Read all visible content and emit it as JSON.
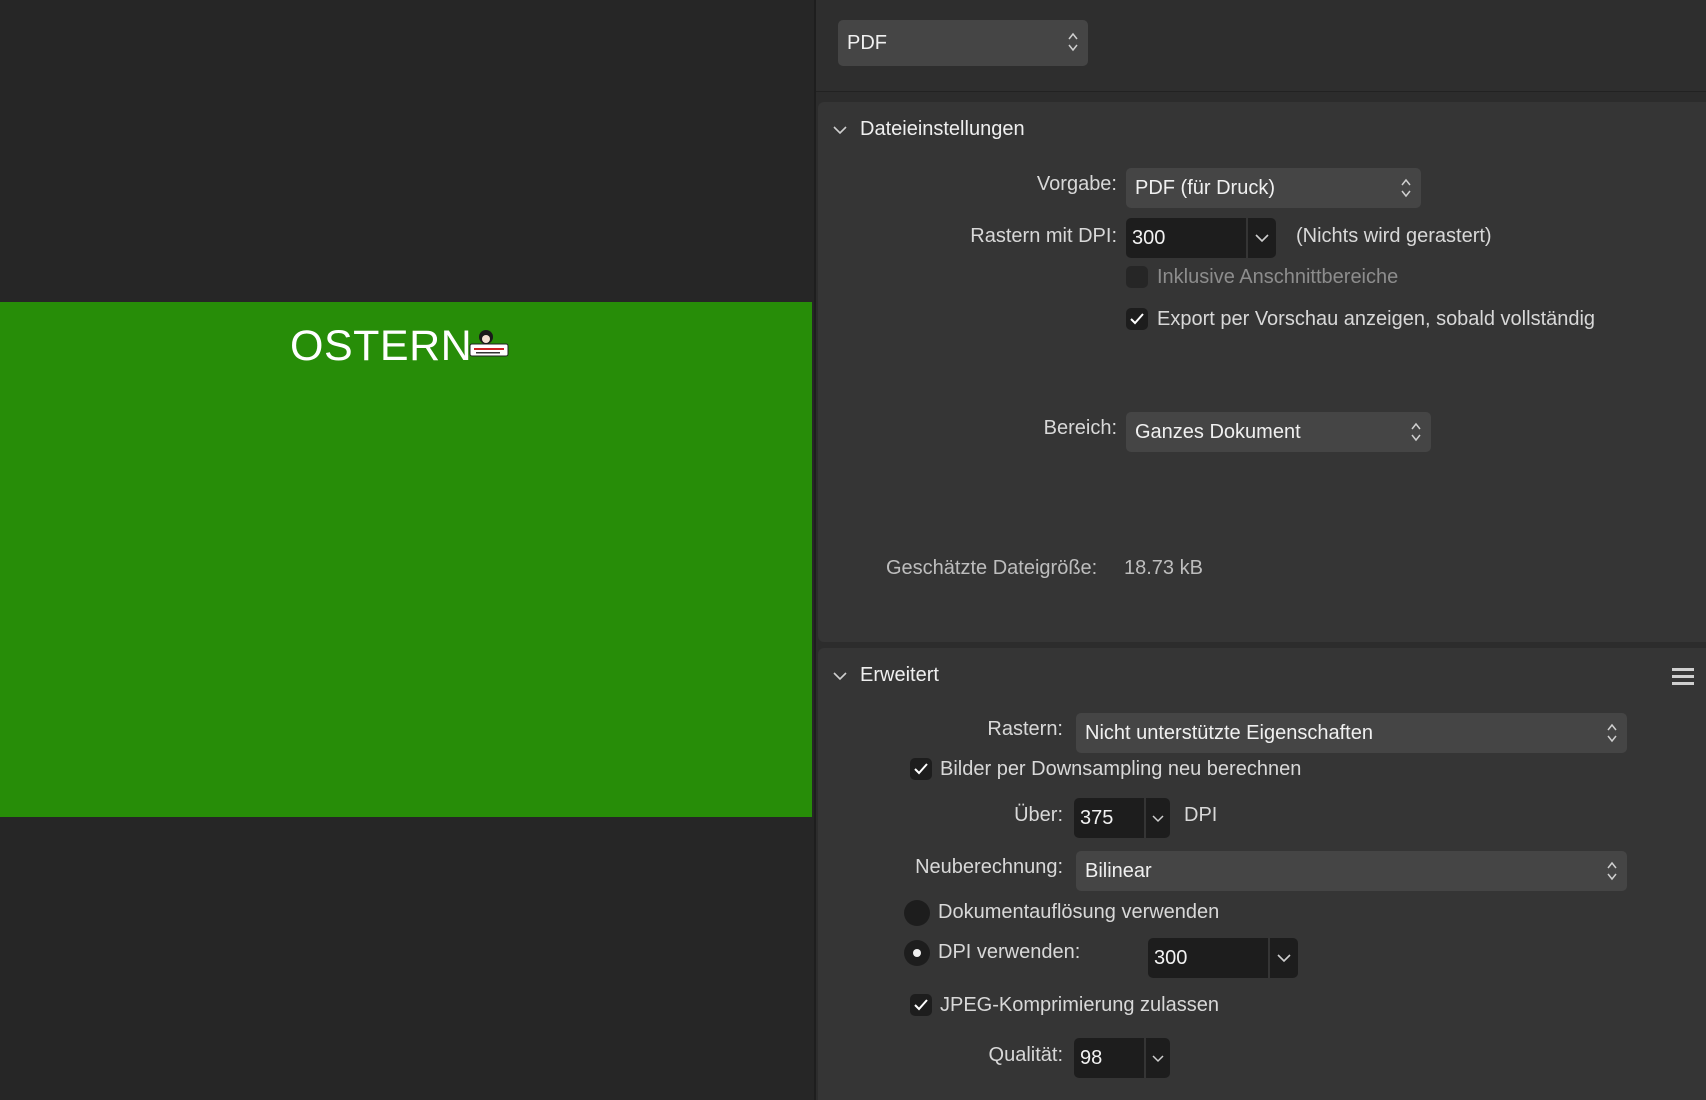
{
  "preview": {
    "title": "OSTERN",
    "background_color": "#278d08"
  },
  "format": {
    "selected": "PDF"
  },
  "file_settings": {
    "header": "Dateieinstellungen",
    "preset_label": "Vorgabe:",
    "preset_value": "PDF (für Druck)",
    "raster_dpi_label": "Rastern mit DPI:",
    "raster_dpi_value": "300",
    "raster_note": "(Nichts wird gerastert)",
    "include_bleed_label": "Inklusive Anschnittbereiche",
    "include_bleed_checked": false,
    "preview_export_label": "Export per Vorschau anzeigen, sobald vollständig",
    "preview_export_checked": true,
    "area_label": "Bereich:",
    "area_value": "Ganzes Dokument",
    "filesize_label": "Geschätzte Dateigröße:",
    "filesize_value": "18.73 kB"
  },
  "advanced": {
    "header": "Erweitert",
    "rasterize_label": "Rastern:",
    "rasterize_value": "Nicht unterstützte Eigenschaften",
    "downsample_label": "Bilder per Downsampling neu berechnen",
    "downsample_checked": true,
    "over_label": "Über:",
    "over_value": "375",
    "over_unit": "DPI",
    "resample_label": "Neuberechnung:",
    "resample_value": "Bilinear",
    "use_doc_res_label": "Dokumentauflösung verwenden",
    "use_dpi_label": "DPI verwenden:",
    "use_dpi_value": "300",
    "selected_option": "DPI verwenden",
    "jpeg_label": "JPEG-Komprimierung zulassen",
    "jpeg_checked": true,
    "quality_label": "Qualität:",
    "quality_value": "98"
  },
  "icons": {
    "chevron": "chevron-down-icon",
    "stepper": "up-down-arrows-icon",
    "check": "checkmark-icon",
    "menu": "hamburger-menu-icon"
  }
}
